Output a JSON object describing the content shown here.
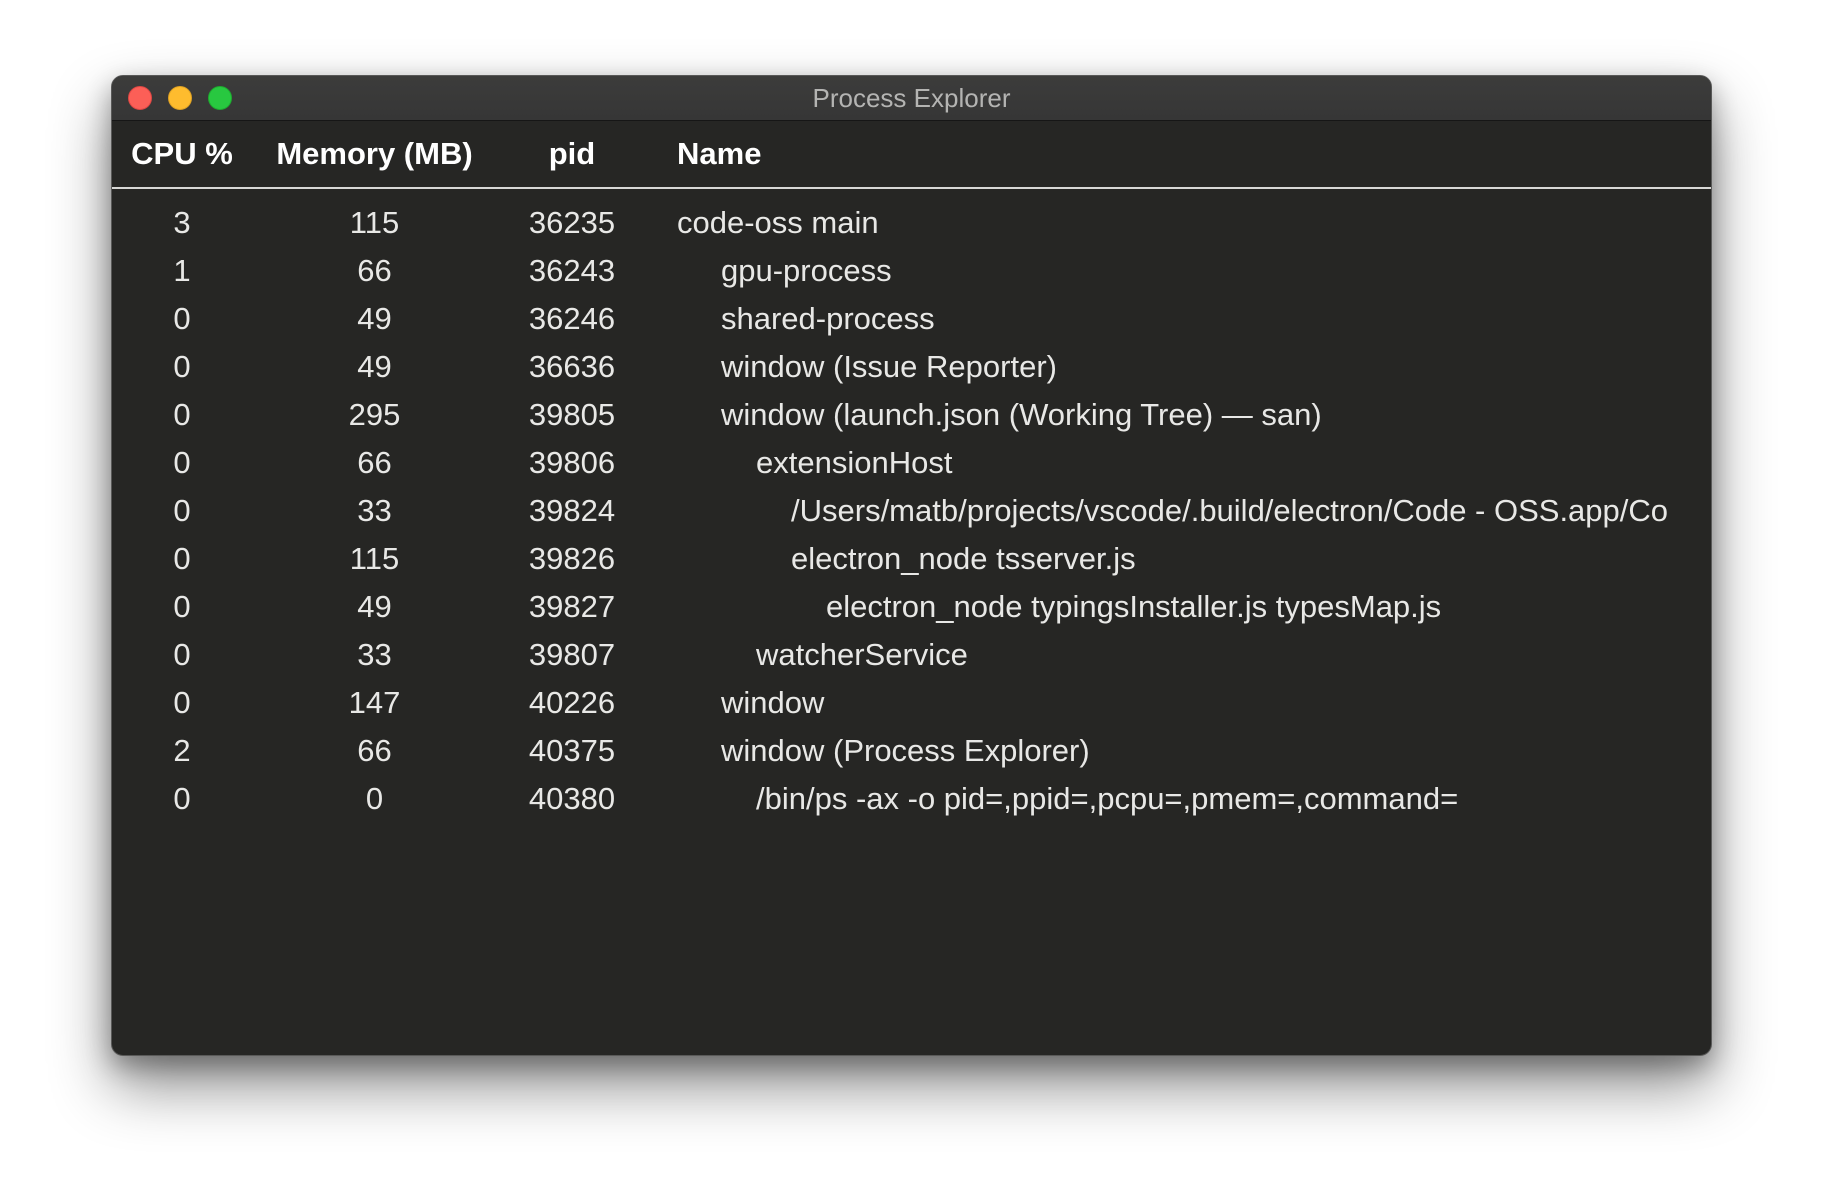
{
  "window": {
    "title": "Process Explorer"
  },
  "table": {
    "headers": {
      "cpu": "CPU %",
      "memory": "Memory (MB)",
      "pid": "pid",
      "name": "Name"
    },
    "rows": [
      {
        "cpu": "3",
        "memory": "115",
        "pid": "36235",
        "name": "code-oss main",
        "depth": 0
      },
      {
        "cpu": "1",
        "memory": "66",
        "pid": "36243",
        "name": "gpu-process",
        "depth": 1
      },
      {
        "cpu": "0",
        "memory": "49",
        "pid": "36246",
        "name": "shared-process",
        "depth": 1
      },
      {
        "cpu": "0",
        "memory": "49",
        "pid": "36636",
        "name": "window (Issue Reporter)",
        "depth": 1
      },
      {
        "cpu": "0",
        "memory": "295",
        "pid": "39805",
        "name": "window (launch.json (Working Tree) — san)",
        "depth": 1
      },
      {
        "cpu": "0",
        "memory": "66",
        "pid": "39806",
        "name": "extensionHost",
        "depth": 2
      },
      {
        "cpu": "0",
        "memory": "33",
        "pid": "39824",
        "name": "/Users/matb/projects/vscode/.build/electron/Code - OSS.app/Co",
        "depth": 3
      },
      {
        "cpu": "0",
        "memory": "115",
        "pid": "39826",
        "name": "electron_node tsserver.js",
        "depth": 3
      },
      {
        "cpu": "0",
        "memory": "49",
        "pid": "39827",
        "name": "electron_node typingsInstaller.js typesMap.js",
        "depth": 4
      },
      {
        "cpu": "0",
        "memory": "33",
        "pid": "39807",
        "name": "watcherService",
        "depth": 2
      },
      {
        "cpu": "0",
        "memory": "147",
        "pid": "40226",
        "name": "window",
        "depth": 1
      },
      {
        "cpu": "2",
        "memory": "66",
        "pid": "40375",
        "name": "window (Process Explorer)",
        "depth": 1
      },
      {
        "cpu": "0",
        "memory": "0",
        "pid": "40380",
        "name": "/bin/ps -ax -o pid=,ppid=,pcpu=,pmem=,command=",
        "depth": 2
      }
    ]
  }
}
